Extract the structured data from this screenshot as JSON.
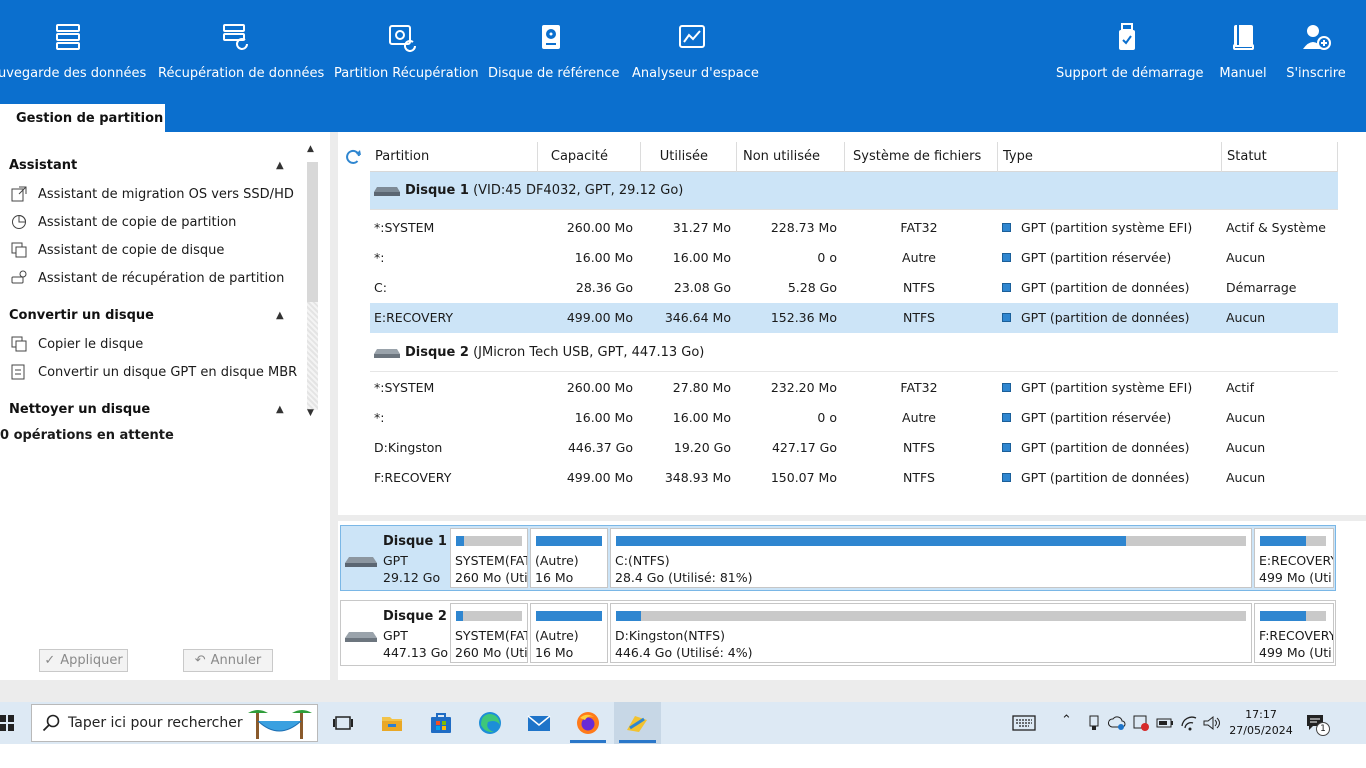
{
  "ribbon": {
    "tools": [
      {
        "label": "uvegarde des données",
        "icon": "backup-icon"
      },
      {
        "label": "Récupération de données",
        "icon": "data-recovery-icon"
      },
      {
        "label": "Partition Récupération",
        "icon": "partition-recovery-icon"
      },
      {
        "label": "Disque de référence",
        "icon": "disk-benchmark-icon"
      },
      {
        "label": "Analyseur d'espace",
        "icon": "space-analyzer-icon"
      },
      {
        "label": "Support de démarrage",
        "icon": "bootable-media-icon"
      },
      {
        "label": "Manuel",
        "icon": "manual-icon"
      },
      {
        "label": "S'inscrire",
        "icon": "register-icon"
      }
    ],
    "active_tab": "Gestion de partition"
  },
  "sidebar": {
    "sections": [
      {
        "title": "Assistant",
        "items": [
          "Assistant de migration OS vers SSD/HD",
          "Assistant de copie de partition",
          "Assistant de copie de disque",
          "Assistant de récupération de partition"
        ]
      },
      {
        "title": "Convertir un disque",
        "items": [
          "Copier le disque",
          "Convertir un disque GPT en disque MBR"
        ]
      },
      {
        "title": "Nettoyer un disque",
        "items": []
      }
    ],
    "pending": "0 opérations en attente",
    "apply_label": "Appliquer",
    "undo_label": "Annuler"
  },
  "table": {
    "headers": [
      "Partition",
      "Capacité",
      "Utilisée",
      "Non utilisée",
      "Système de fichiers",
      "Type",
      "Statut"
    ],
    "disks": [
      {
        "name": "Disque 1",
        "detail": "(VID:45 DF4032, GPT, 29.12 Go)",
        "partitions": [
          {
            "partition": "*:SYSTEM",
            "capacity": "260.00 Mo",
            "used": "31.27 Mo",
            "unused": "228.73 Mo",
            "fs": "FAT32",
            "type": "GPT (partition système EFI)",
            "status": "Actif & Système"
          },
          {
            "partition": "*:",
            "capacity": "16.00 Mo",
            "used": "16.00 Mo",
            "unused": "0 o",
            "fs": "Autre",
            "type": "GPT (partition réservée)",
            "status": "Aucun"
          },
          {
            "partition": "C:",
            "capacity": "28.36 Go",
            "used": "23.08 Go",
            "unused": "5.28 Go",
            "fs": "NTFS",
            "type": "GPT (partition de données)",
            "status": "Démarrage"
          },
          {
            "partition": "E:RECOVERY",
            "capacity": "499.00 Mo",
            "used": "346.64 Mo",
            "unused": "152.36 Mo",
            "fs": "NTFS",
            "type": "GPT (partition de données)",
            "status": "Aucun"
          }
        ]
      },
      {
        "name": "Disque 2",
        "detail": "(JMicron Tech USB, GPT, 447.13 Go)",
        "partitions": [
          {
            "partition": "*:SYSTEM",
            "capacity": "260.00 Mo",
            "used": "27.80 Mo",
            "unused": "232.20 Mo",
            "fs": "FAT32",
            "type": "GPT (partition système EFI)",
            "status": "Actif"
          },
          {
            "partition": "*:",
            "capacity": "16.00 Mo",
            "used": "16.00 Mo",
            "unused": "0 o",
            "fs": "Autre",
            "type": "GPT (partition réservée)",
            "status": "Aucun"
          },
          {
            "partition": "D:Kingston",
            "capacity": "446.37 Go",
            "used": "19.20 Go",
            "unused": "427.17 Go",
            "fs": "NTFS",
            "type": "GPT (partition de données)",
            "status": "Aucun"
          },
          {
            "partition": "F:RECOVERY",
            "capacity": "499.00 Mo",
            "used": "348.93 Mo",
            "unused": "150.07 Mo",
            "fs": "NTFS",
            "type": "GPT (partition de données)",
            "status": "Aucun"
          }
        ]
      }
    ]
  },
  "diskmap": [
    {
      "name": "Disque 1",
      "style": "GPT",
      "size": "29.12 Go",
      "blocks": [
        {
          "line1": "SYSTEM(FAT",
          "line2": "260 Mo (Uti",
          "used_fraction": 0.12
        },
        {
          "line1": "(Autre)",
          "line2": "16 Mo",
          "used_fraction": 1.0
        },
        {
          "line1": "C:(NTFS)",
          "line2": "28.4 Go (Utilisé: 81%)",
          "used_fraction": 0.81
        },
        {
          "line1": "E:RECOVERY",
          "line2": "499 Mo (Uti",
          "used_fraction": 0.69
        }
      ]
    },
    {
      "name": "Disque 2",
      "style": "GPT",
      "size": "447.13 Go",
      "blocks": [
        {
          "line1": "SYSTEM(FAT",
          "line2": "260 Mo (Uti",
          "used_fraction": 0.11
        },
        {
          "line1": "(Autre)",
          "line2": "16 Mo",
          "used_fraction": 1.0
        },
        {
          "line1": "D:Kingston(NTFS)",
          "line2": "446.4 Go (Utilisé: 4%)",
          "used_fraction": 0.04
        },
        {
          "line1": "F:RECOVERY",
          "line2": "499 Mo (Uti",
          "used_fraction": 0.7
        }
      ]
    }
  ],
  "taskbar": {
    "search_placeholder": "Taper ici pour rechercher",
    "time": "17:17",
    "date": "27/05/2024",
    "notification_count": "1"
  },
  "colors": {
    "ribbon": "#0b6fce",
    "selection": "#cce4f7",
    "bar_fill": "#2f86d0",
    "bar_empty": "#c9c9c9"
  }
}
